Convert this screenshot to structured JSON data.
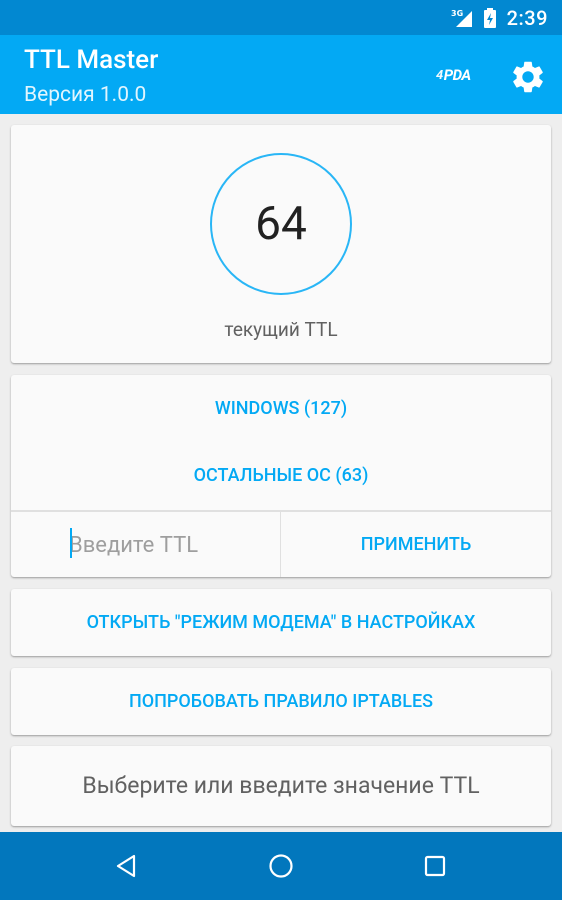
{
  "status_bar": {
    "network": "3G",
    "time": "2:39",
    "icons": [
      "signal-icon",
      "battery-charging-icon"
    ]
  },
  "app_bar": {
    "title": "TTL Master",
    "subtitle": "Версия 1.0.0",
    "logo_text": "PDA",
    "logo_prefix": "4",
    "settings_icon": "gear-icon"
  },
  "ttl_card": {
    "value": "64",
    "caption": "текущий TTL"
  },
  "os_card": {
    "windows_label": "WINDOWS (127)",
    "other_os_label": "ОСТАЛЬНЫЕ ОС (63)",
    "input_placeholder": "Введите TTL",
    "input_value": "",
    "apply_label": "ПРИМЕНИТЬ"
  },
  "modem_button": "ОТКРЫТЬ \"РЕЖИМ МОДЕМА\" В НАСТРОЙКАХ",
  "iptables_button": "ПОПРОБОВАТЬ ПРАВИЛО IPTABLES",
  "hint_text": "Выберите или введите значение TTL",
  "nav_bar": {
    "icons": [
      "back-icon",
      "home-icon",
      "recents-icon"
    ]
  },
  "colors": {
    "status_bar": "#0288D1",
    "app_bar": "#03A9F4",
    "accent": "#03A9F4",
    "nav_bar": "#0277BD",
    "background": "#EEEEEE"
  }
}
